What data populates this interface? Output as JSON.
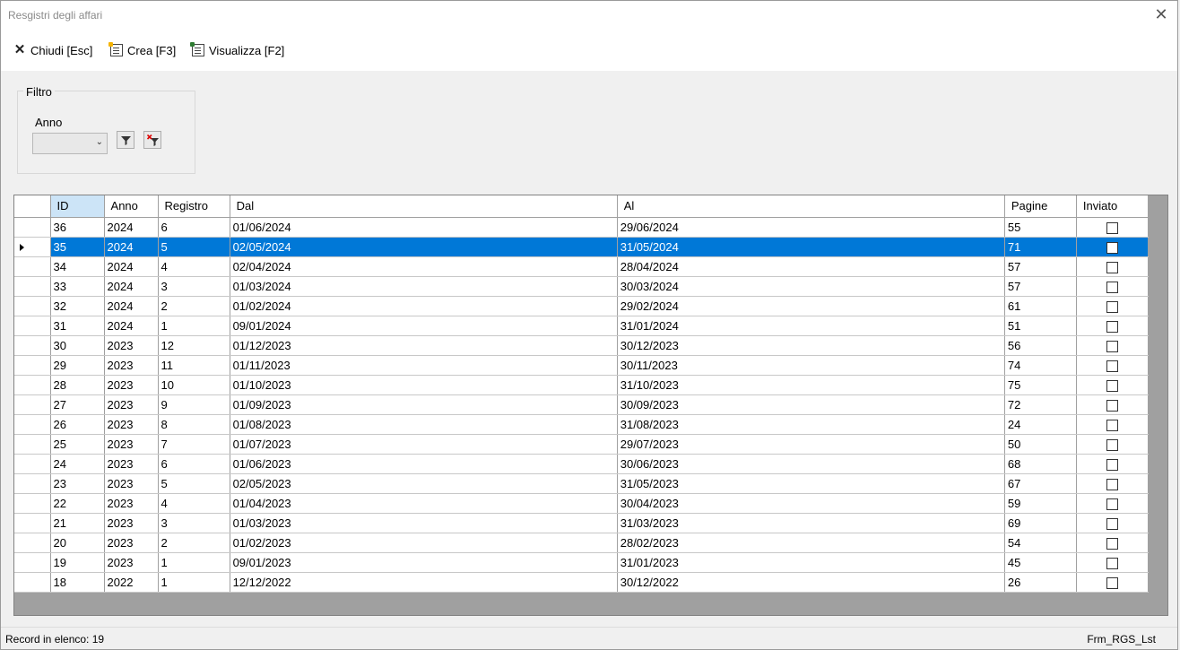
{
  "window": {
    "title": "Resgistri degli affari",
    "close_glyph": "✕"
  },
  "toolbar": {
    "close_label": "Chiudi [Esc]",
    "create_label": "Crea [F3]",
    "view_label": "Visualizza [F2]"
  },
  "filter": {
    "legend": "Filtro",
    "year_label": "Anno",
    "year_value": ""
  },
  "grid": {
    "columns": [
      "ID",
      "Anno",
      "Registro",
      "Dal",
      "Al",
      "Pagine",
      "Inviato"
    ],
    "selected_id": "35",
    "rows": [
      {
        "id": "36",
        "anno": "2024",
        "registro": "6",
        "dal": "01/06/2024",
        "al": "29/06/2024",
        "pagine": "55",
        "inviato": false
      },
      {
        "id": "35",
        "anno": "2024",
        "registro": "5",
        "dal": "02/05/2024",
        "al": "31/05/2024",
        "pagine": "71",
        "inviato": false
      },
      {
        "id": "34",
        "anno": "2024",
        "registro": "4",
        "dal": "02/04/2024",
        "al": "28/04/2024",
        "pagine": "57",
        "inviato": false
      },
      {
        "id": "33",
        "anno": "2024",
        "registro": "3",
        "dal": "01/03/2024",
        "al": "30/03/2024",
        "pagine": "57",
        "inviato": false
      },
      {
        "id": "32",
        "anno": "2024",
        "registro": "2",
        "dal": "01/02/2024",
        "al": "29/02/2024",
        "pagine": "61",
        "inviato": false
      },
      {
        "id": "31",
        "anno": "2024",
        "registro": "1",
        "dal": "09/01/2024",
        "al": "31/01/2024",
        "pagine": "51",
        "inviato": false
      },
      {
        "id": "30",
        "anno": "2023",
        "registro": "12",
        "dal": "01/12/2023",
        "al": "30/12/2023",
        "pagine": "56",
        "inviato": false
      },
      {
        "id": "29",
        "anno": "2023",
        "registro": "11",
        "dal": "01/11/2023",
        "al": "30/11/2023",
        "pagine": "74",
        "inviato": false
      },
      {
        "id": "28",
        "anno": "2023",
        "registro": "10",
        "dal": "01/10/2023",
        "al": "31/10/2023",
        "pagine": "75",
        "inviato": false
      },
      {
        "id": "27",
        "anno": "2023",
        "registro": "9",
        "dal": "01/09/2023",
        "al": "30/09/2023",
        "pagine": "72",
        "inviato": false
      },
      {
        "id": "26",
        "anno": "2023",
        "registro": "8",
        "dal": "01/08/2023",
        "al": "31/08/2023",
        "pagine": "24",
        "inviato": false
      },
      {
        "id": "25",
        "anno": "2023",
        "registro": "7",
        "dal": "01/07/2023",
        "al": "29/07/2023",
        "pagine": "50",
        "inviato": false
      },
      {
        "id": "24",
        "anno": "2023",
        "registro": "6",
        "dal": "01/06/2023",
        "al": "30/06/2023",
        "pagine": "68",
        "inviato": false
      },
      {
        "id": "23",
        "anno": "2023",
        "registro": "5",
        "dal": "02/05/2023",
        "al": "31/05/2023",
        "pagine": "67",
        "inviato": false
      },
      {
        "id": "22",
        "anno": "2023",
        "registro": "4",
        "dal": "01/04/2023",
        "al": "30/04/2023",
        "pagine": "59",
        "inviato": false
      },
      {
        "id": "21",
        "anno": "2023",
        "registro": "3",
        "dal": "01/03/2023",
        "al": "31/03/2023",
        "pagine": "69",
        "inviato": false
      },
      {
        "id": "20",
        "anno": "2023",
        "registro": "2",
        "dal": "01/02/2023",
        "al": "28/02/2023",
        "pagine": "54",
        "inviato": false
      },
      {
        "id": "19",
        "anno": "2023",
        "registro": "1",
        "dal": "09/01/2023",
        "al": "31/01/2023",
        "pagine": "45",
        "inviato": false
      },
      {
        "id": "18",
        "anno": "2022",
        "registro": "1",
        "dal": "12/12/2022",
        "al": "30/12/2022",
        "pagine": "26",
        "inviato": false
      }
    ]
  },
  "status": {
    "record_count_text": "Record in elenco: 19",
    "form_name": "Frm_RGS_Lst"
  },
  "colors": {
    "selection": "#0078d7",
    "sorted_header": "#cce4f7",
    "grid_background": "#a0a0a0"
  },
  "icons": {
    "close": "close-icon",
    "create": "new-document-icon",
    "view": "view-document-icon",
    "apply_filter": "filter-icon",
    "clear_filter": "clear-filter-icon"
  }
}
